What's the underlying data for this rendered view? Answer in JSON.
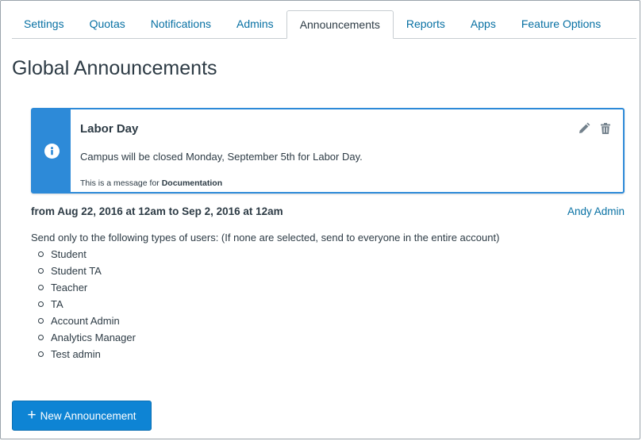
{
  "tabs": [
    {
      "label": "Settings",
      "active": false
    },
    {
      "label": "Quotas",
      "active": false
    },
    {
      "label": "Notifications",
      "active": false
    },
    {
      "label": "Admins",
      "active": false
    },
    {
      "label": "Announcements",
      "active": true
    },
    {
      "label": "Reports",
      "active": false
    },
    {
      "label": "Apps",
      "active": false
    },
    {
      "label": "Feature Options",
      "active": false
    }
  ],
  "page": {
    "title": "Global Announcements"
  },
  "announcement": {
    "title": "Labor Day",
    "message": "Campus will be closed Monday, September 5th for Labor Day.",
    "footer_prefix": "This is a message for",
    "footer_account": "Documentation",
    "icon": "info-icon",
    "accent_color": "#2d8ad8",
    "date_range": "from Aug 22, 2016 at 12am to Sep 2, 2016 at 12am",
    "author": "Andy Admin",
    "recipients_note": "Send only to the following types of users: (If none are selected, send to everyone in the entire account)",
    "roles": [
      "Student",
      "Student TA",
      "Teacher",
      "TA",
      "Account Admin",
      "Analytics Manager",
      "Test admin"
    ]
  },
  "actions": {
    "edit_icon": "pencil-icon",
    "delete_icon": "trash-icon",
    "new_button_label": "New Announcement",
    "new_button_icon": "plus-icon",
    "button_color": "#0e84d4"
  }
}
